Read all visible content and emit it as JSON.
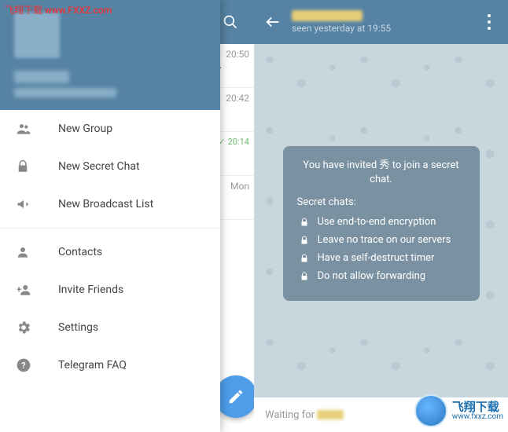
{
  "watermark": {
    "top_label": "飞翔下载 www.FXXZ.com",
    "brand": "飞翔下载",
    "url": "www.fxxz.com"
  },
  "drawer": {
    "menu": {
      "new_group": "New Group",
      "new_secret_chat": "New Secret Chat",
      "new_broadcast_list": "New Broadcast List",
      "contacts": "Contacts",
      "invite_friends": "Invite Friends",
      "settings": "Settings",
      "telegram_faq": "Telegram FAQ"
    }
  },
  "chat_list": {
    "rows": [
      {
        "time": "20:50",
        "preview": "a..."
      },
      {
        "time": "20:42",
        "preview": ""
      },
      {
        "time": "20:14",
        "preview": ""
      },
      {
        "time": "Mon",
        "preview": ""
      }
    ]
  },
  "chat": {
    "last_seen": "seen yesterday at 19:55",
    "info": {
      "invite_line": "You have invited 秀 to join a secret chat.",
      "heading": "Secret chats:",
      "features": [
        "Use end-to-end encryption",
        "Leave no trace on our servers",
        "Have a self-destruct timer",
        "Do not allow forwarding"
      ]
    },
    "input_waiting": "Waiting for"
  }
}
